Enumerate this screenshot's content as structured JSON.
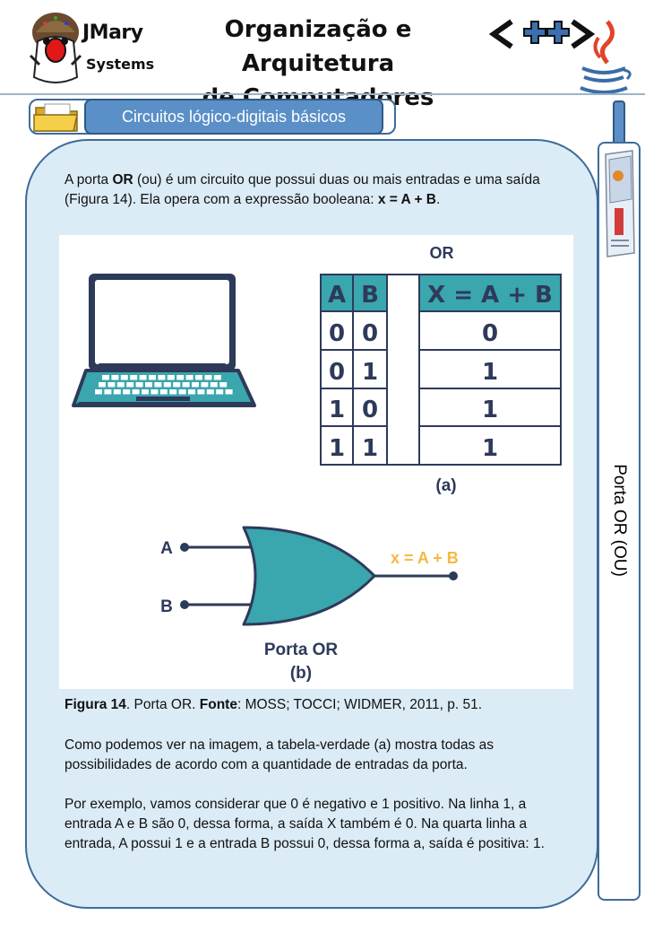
{
  "header": {
    "brand_line1": "JMary",
    "brand_line2": "Systems",
    "title_line1": "Organização e Arquitetura",
    "title_line2": "de Computadores"
  },
  "section": {
    "title": "Circuitos lógico-digitais básicos"
  },
  "side_tab": {
    "label": "Porta OR (OU)"
  },
  "content": {
    "p1_part1": "A porta ",
    "p1_bold1": "OR",
    "p1_part2": " (ou) é um circuito que possui duas ou mais entradas e uma saída (Figura 14). Ela opera com a expressão booleana: ",
    "p1_bold2": "x = A + B",
    "p1_part3": ".",
    "caption_fig": "Figura 14",
    "caption_part1": ". Porta OR. ",
    "caption_fonte": "Fonte",
    "caption_part2": ": MOSS; TOCCI; WIDMER, 2011, p. 51.",
    "p2": "Como podemos ver na imagem, a tabela-verdade (a) mostra todas as possibilidades de acordo com a quantidade de entradas da porta.",
    "p3": "Por exemplo, vamos considerar que 0 é negativo e 1 positivo. Na linha 1, a entrada A e B são 0, dessa forma, a saída X também é 0. Na quarta linha a entrada, A possui 1 e a entrada B possui 0, dessa forma a, saída é positiva: 1."
  },
  "figure": {
    "table_title": "OR",
    "headers": [
      "A",
      "B",
      "X = A + B"
    ],
    "rows": [
      [
        "0",
        "0",
        "0"
      ],
      [
        "0",
        "1",
        "1"
      ],
      [
        "1",
        "0",
        "1"
      ],
      [
        "1",
        "1",
        "1"
      ]
    ],
    "label_a": "(a)",
    "input_a": "A",
    "input_b": "B",
    "output_expr": "x = A + B",
    "gate_name": "Porta OR",
    "label_b": "(b)"
  },
  "colors": {
    "teal": "#3aa6ad",
    "navy": "#2e3a5a",
    "output_orange": "#f4b942",
    "content_bg": "#dbecf6",
    "section_blue": "#5b8fc7"
  }
}
